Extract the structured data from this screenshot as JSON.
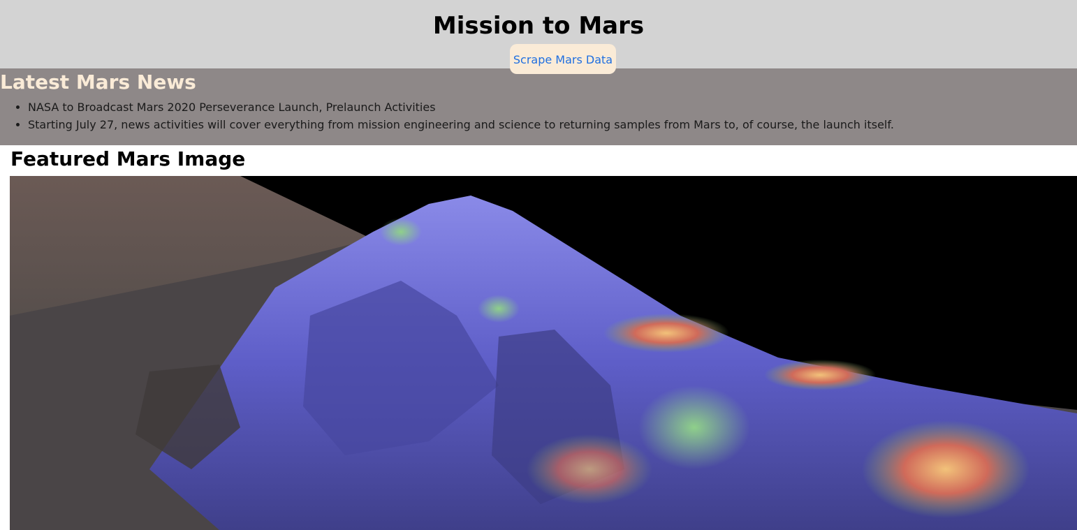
{
  "header": {
    "title": "Mission to Mars",
    "scrape_button": "Scrape Mars Data"
  },
  "news": {
    "heading": "Latest Mars News",
    "items": [
      "NASA to Broadcast Mars 2020 Perseverance Launch, Prelaunch Activities",
      "Starting July 27, news activities will cover everything from mission engineering and science to returning samples from Mars to, of course, the launch itself."
    ]
  },
  "featured": {
    "heading": "Featured Mars Image",
    "image_icon": "mars-terrain-image"
  },
  "colors": {
    "header_bg": "#d3d3d3",
    "news_bg": "#8e8888",
    "news_heading": "#faebd7",
    "button_bg": "#faebd7",
    "button_text": "#1f6fe0"
  }
}
